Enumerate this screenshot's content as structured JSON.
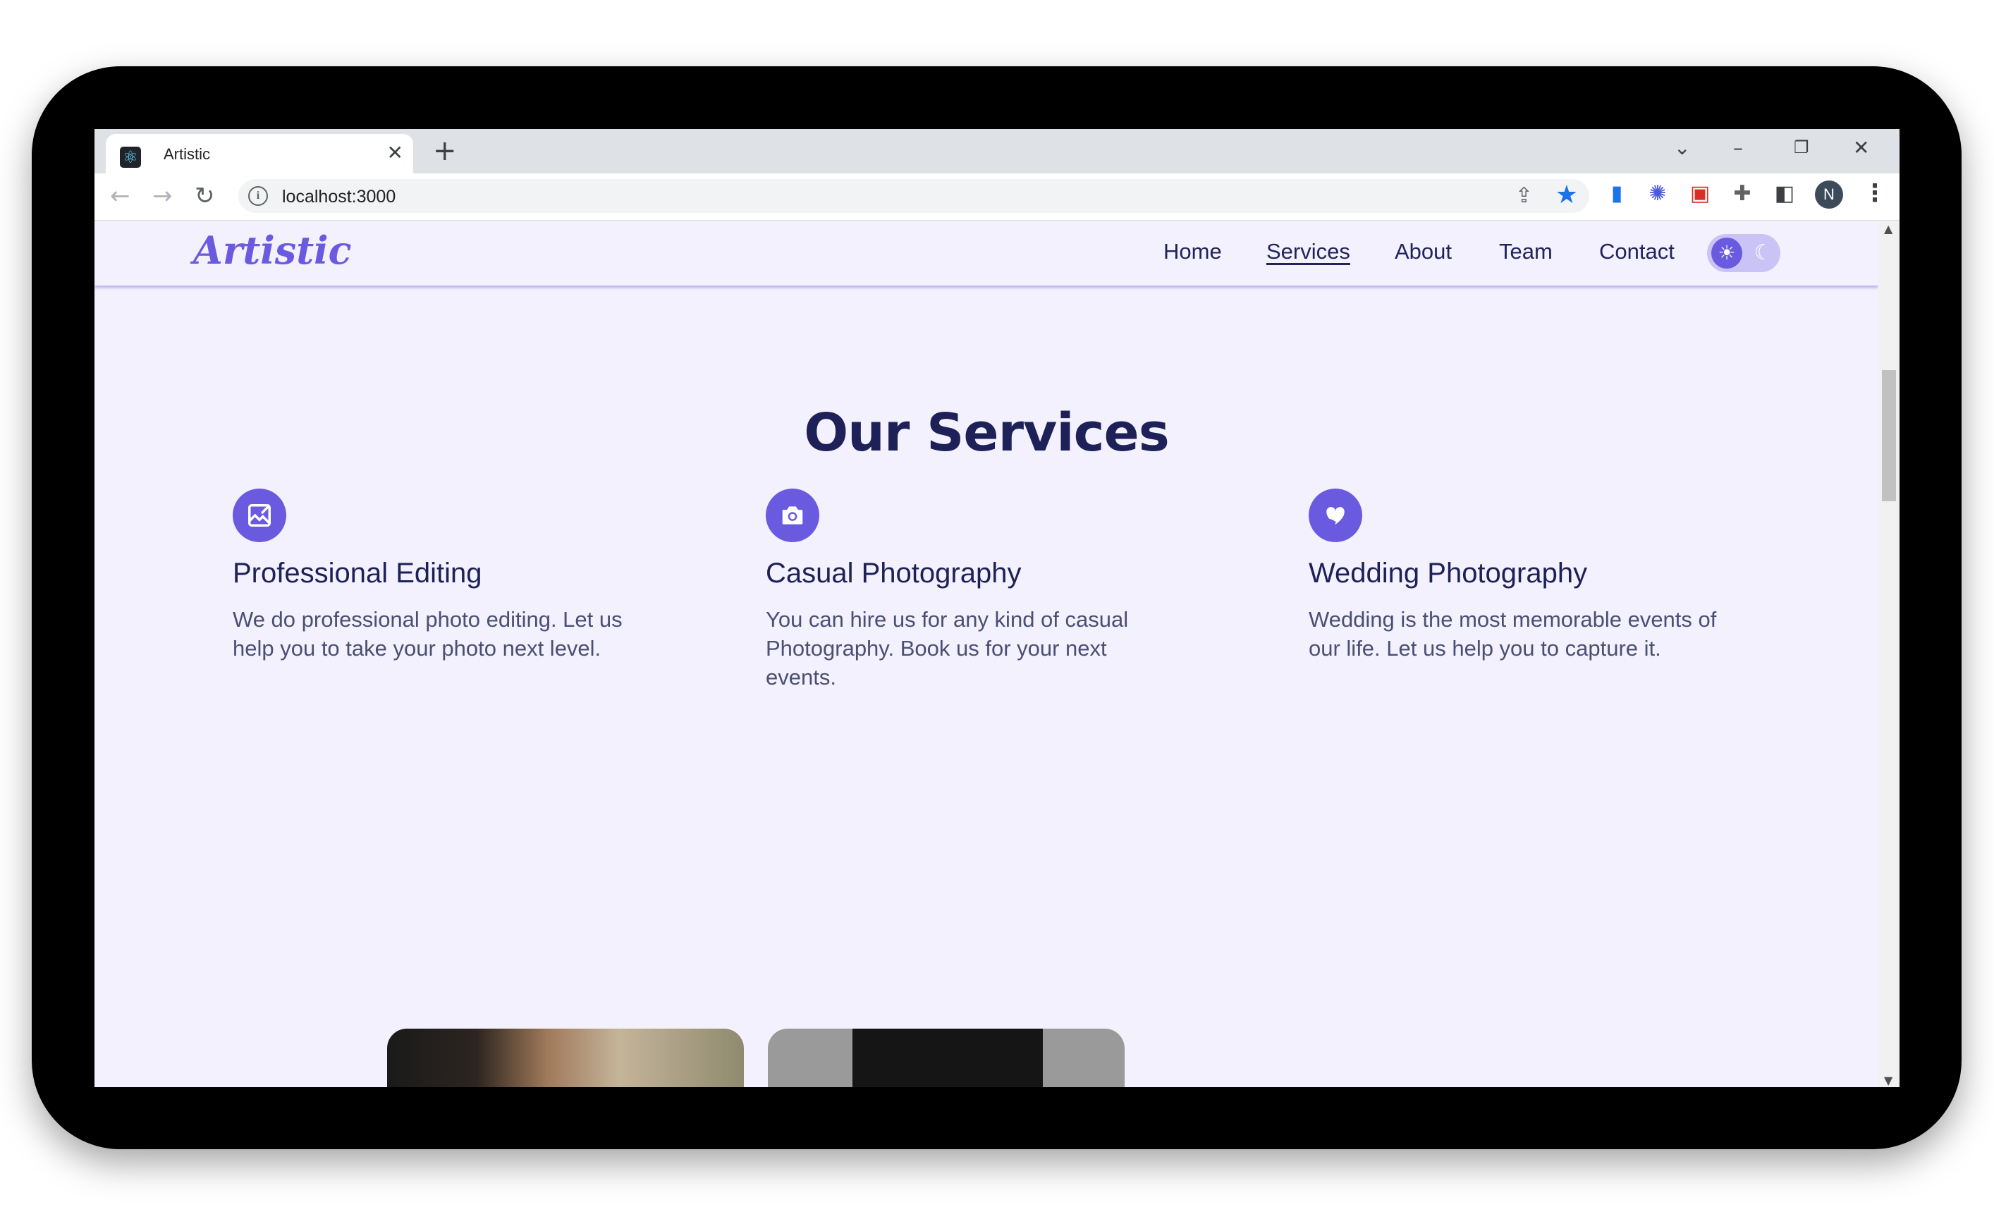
{
  "browser": {
    "tab_title": "Artistic",
    "url": "localhost:3000",
    "profile_initial": "N"
  },
  "site": {
    "logo": "Artistic",
    "nav": [
      {
        "label": "Home"
      },
      {
        "label": "Services",
        "active": true
      },
      {
        "label": "About"
      },
      {
        "label": "Team"
      },
      {
        "label": "Contact"
      }
    ],
    "theme": "light"
  },
  "services": {
    "title": "Our Services",
    "items": [
      {
        "icon": "image-edit-icon",
        "title": "Professional Editing",
        "description": "We do professional photo editing. Let us help you to take your photo next level."
      },
      {
        "icon": "camera-icon",
        "title": "Casual Photography",
        "description": "You can hire us for any kind of casual Photography. Book us for your next events."
      },
      {
        "icon": "heart-hand-icon",
        "title": "Wedding Photography",
        "description": "Wedding is the most memorable events of our life. Let us help you to capture it."
      }
    ]
  },
  "colors": {
    "accent": "#6a5ae0",
    "heading": "#1e2157",
    "page_bg": "#f3f1fd"
  }
}
